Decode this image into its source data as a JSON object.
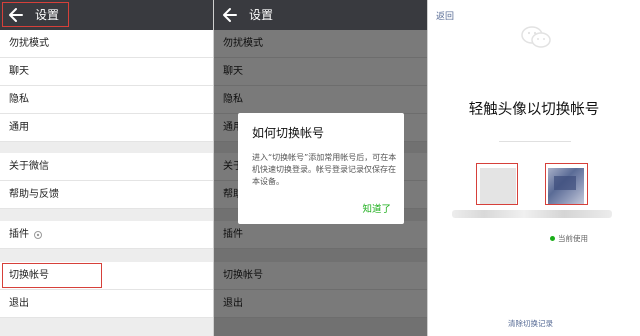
{
  "settings": {
    "title": "设置",
    "items": [
      {
        "label": "勿扰模式"
      },
      {
        "label": "聊天"
      },
      {
        "label": "隐私"
      },
      {
        "label": "通用"
      },
      {
        "label": "关于微信"
      },
      {
        "label": "帮助与反馈"
      },
      {
        "label": "插件"
      },
      {
        "label": "切换帐号"
      },
      {
        "label": "退出"
      }
    ]
  },
  "dialog": {
    "title": "如何切换帐号",
    "body": "进入“切换帐号”添加常用帐号后，可在本机快速切换登录。帐号登录记录仅保存在本设备。",
    "ok_label": "知道了"
  },
  "switch_screen": {
    "back_label": "返回",
    "title": "轻触头像以切换帐号",
    "current_label": "当前使用",
    "bottom_link": "清除切换记录"
  },
  "colors": {
    "titlebar": "#393a3f",
    "accent_green": "#1aad19",
    "link_blue": "#576b95",
    "highlight_red": "#d6403a"
  }
}
